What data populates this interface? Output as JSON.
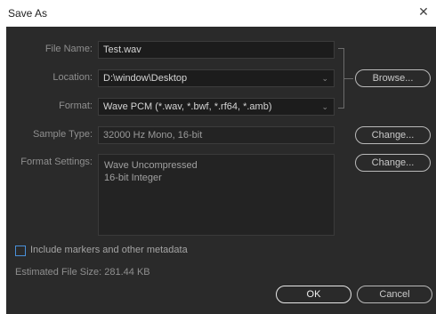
{
  "window": {
    "title": "Save As",
    "close_glyph": "✕"
  },
  "form": {
    "file_name": {
      "label": "File Name:",
      "value": "Test.wav"
    },
    "location": {
      "label": "Location:",
      "value": "D:\\window\\Desktop",
      "chevron": "⌄"
    },
    "format": {
      "label": "Format:",
      "value": "Wave PCM (*.wav, *.bwf, *.rf64, *.amb)",
      "chevron": "⌄"
    },
    "sample_type": {
      "label": "Sample Type:",
      "value": "32000 Hz Mono, 16-bit"
    },
    "format_settings": {
      "label": "Format Settings:",
      "lines": [
        "Wave Uncompressed",
        "16-bit Integer"
      ]
    }
  },
  "buttons": {
    "browse": "Browse...",
    "change_sample": "Change...",
    "change_format": "Change...",
    "ok": "OK",
    "cancel": "Cancel"
  },
  "options": {
    "include_markers": {
      "label": "Include markers and other metadata",
      "checked": false
    }
  },
  "estimated_size": "Estimated File Size: 281.44 KB",
  "icons": {
    "close": "close-icon",
    "dropdown": "chevron-down-icon"
  },
  "colors": {
    "panel_bg": "#2a2a2a",
    "field_bg": "#1c1c1c",
    "checkbox_border": "#4a90d9"
  }
}
